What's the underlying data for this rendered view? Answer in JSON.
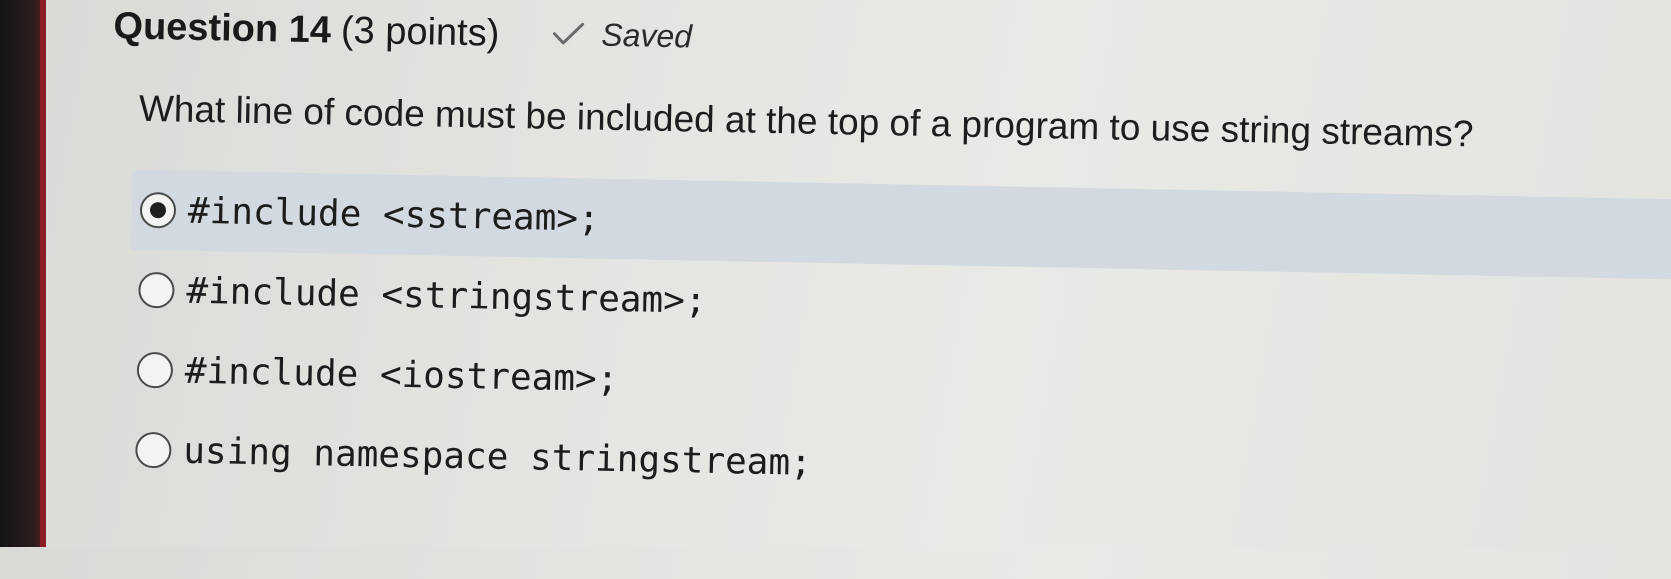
{
  "question": {
    "title": "Question 14",
    "points": "(3 points)",
    "status": "Saved",
    "status_icon": "check-icon",
    "prompt": "What line of code must be included at the top of a program to use string streams?"
  },
  "options": [
    {
      "label": "#include <sstream>;",
      "selected": true
    },
    {
      "label": "#include <stringstream>;",
      "selected": false
    },
    {
      "label": "#include <iostream>;",
      "selected": false
    },
    {
      "label": "using namespace stringstream;",
      "selected": false
    }
  ],
  "colors": {
    "selected_highlight": "#d3d9e0",
    "background": "#e6e6e3",
    "text": "#1e1e1e"
  }
}
